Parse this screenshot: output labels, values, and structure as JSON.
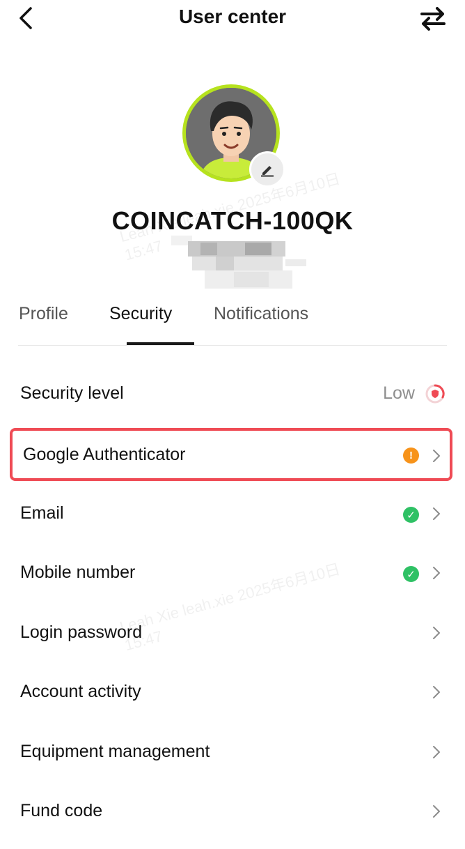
{
  "header": {
    "title": "User center",
    "back_icon": "chevron-left-icon",
    "switch_icon": "swap-arrows-icon"
  },
  "profile": {
    "username": "COINCATCH-100QK",
    "avatar_ring_color": "#b6e21e",
    "edit_icon": "pencil-icon"
  },
  "tabs": [
    {
      "label": "Profile",
      "active": false
    },
    {
      "label": "Security",
      "active": true
    },
    {
      "label": "Notifications",
      "active": false
    }
  ],
  "security_level": {
    "label": "Security level",
    "value": "Low"
  },
  "items": [
    {
      "label": "Google Authenticator",
      "status": "warning"
    },
    {
      "label": "Email",
      "status": "verified"
    },
    {
      "label": "Mobile number",
      "status": "verified"
    },
    {
      "label": "Login password",
      "status": ""
    },
    {
      "label": "Account activity",
      "status": ""
    },
    {
      "label": "Equipment management",
      "status": ""
    },
    {
      "label": "Fund code",
      "status": ""
    }
  ],
  "watermark": {
    "line1": "Leah Xie leah.xie 2025年6月10日",
    "line2": "15:47"
  },
  "colors": {
    "accent_highlight": "#ef4b55",
    "verified": "#2fc165",
    "warning": "#f7931a"
  }
}
